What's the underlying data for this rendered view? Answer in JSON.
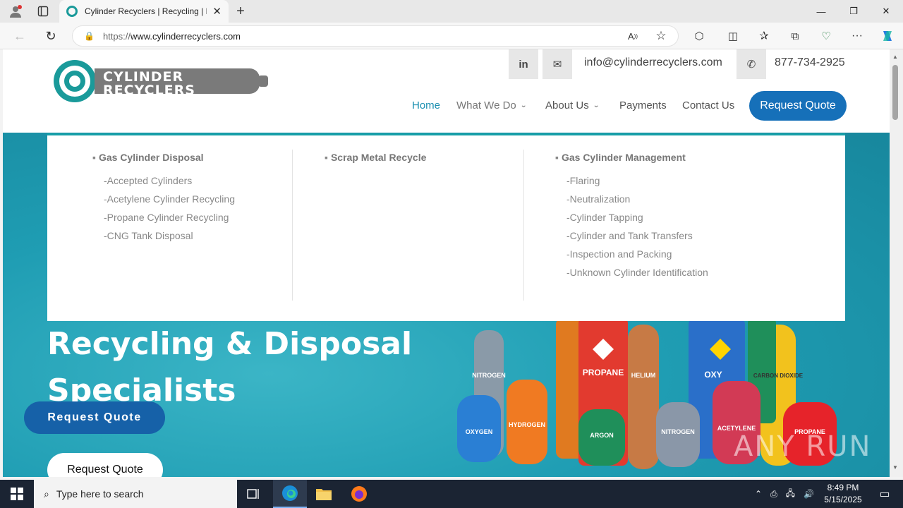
{
  "browser": {
    "tab_title": "Cylinder Recyclers | Recycling | D",
    "url": "https://www.cylinderrecyclers.com",
    "url_scheme": "https://",
    "url_host": "www.cylinderrecyclers.com"
  },
  "site": {
    "logo_line1": "CYLINDER",
    "logo_line2": "RECYCLERS",
    "email": "info@cylinderrecyclers.com",
    "phone": "877-734-2925",
    "nav": {
      "home": "Home",
      "what_we_do": "What We Do",
      "about_us": "About Us",
      "payments": "Payments",
      "contact_us": "Contact Us",
      "request_quote": "Request Quote"
    },
    "megamenu": {
      "col1": {
        "heading": "Gas Cylinder Disposal",
        "items": [
          "Accepted Cylinders",
          "Acetylene Cylinder Recycling",
          "Propane Cylinder Recycling",
          "CNG Tank Disposal"
        ]
      },
      "col2": {
        "heading": "Scrap Metal Recycle",
        "items": []
      },
      "col3": {
        "heading": "Gas Cylinder Management",
        "items": [
          "Flaring",
          "Neutralization",
          "Cylinder Tapping",
          "Cylinder and Tank Transfers",
          "Inspection and Packing",
          "Unknown Cylinder Identification"
        ]
      }
    },
    "hero": {
      "title_line1": "Recycling & Disposal",
      "title_line2": "Specialists",
      "btn_blue": "Request Quote",
      "btn_white": "Request Quote"
    },
    "cylinder_labels": [
      "OXYGEN",
      "HYDROGEN",
      "NITROGEN",
      "PROPANE",
      "HELIUM",
      "ARGON",
      "NITROGEN",
      "ACETYLENE",
      "CARBON DIOXIDE",
      "PROPANE",
      "OXY"
    ]
  },
  "watermark": "ANY RUN",
  "taskbar": {
    "search_placeholder": "Type here to search",
    "time": "8:49 PM",
    "date": "5/15/2025"
  },
  "colors": {
    "accent_teal": "#17a0a8",
    "button_blue": "#1670b9",
    "nav_active": "#1a8fb0"
  }
}
